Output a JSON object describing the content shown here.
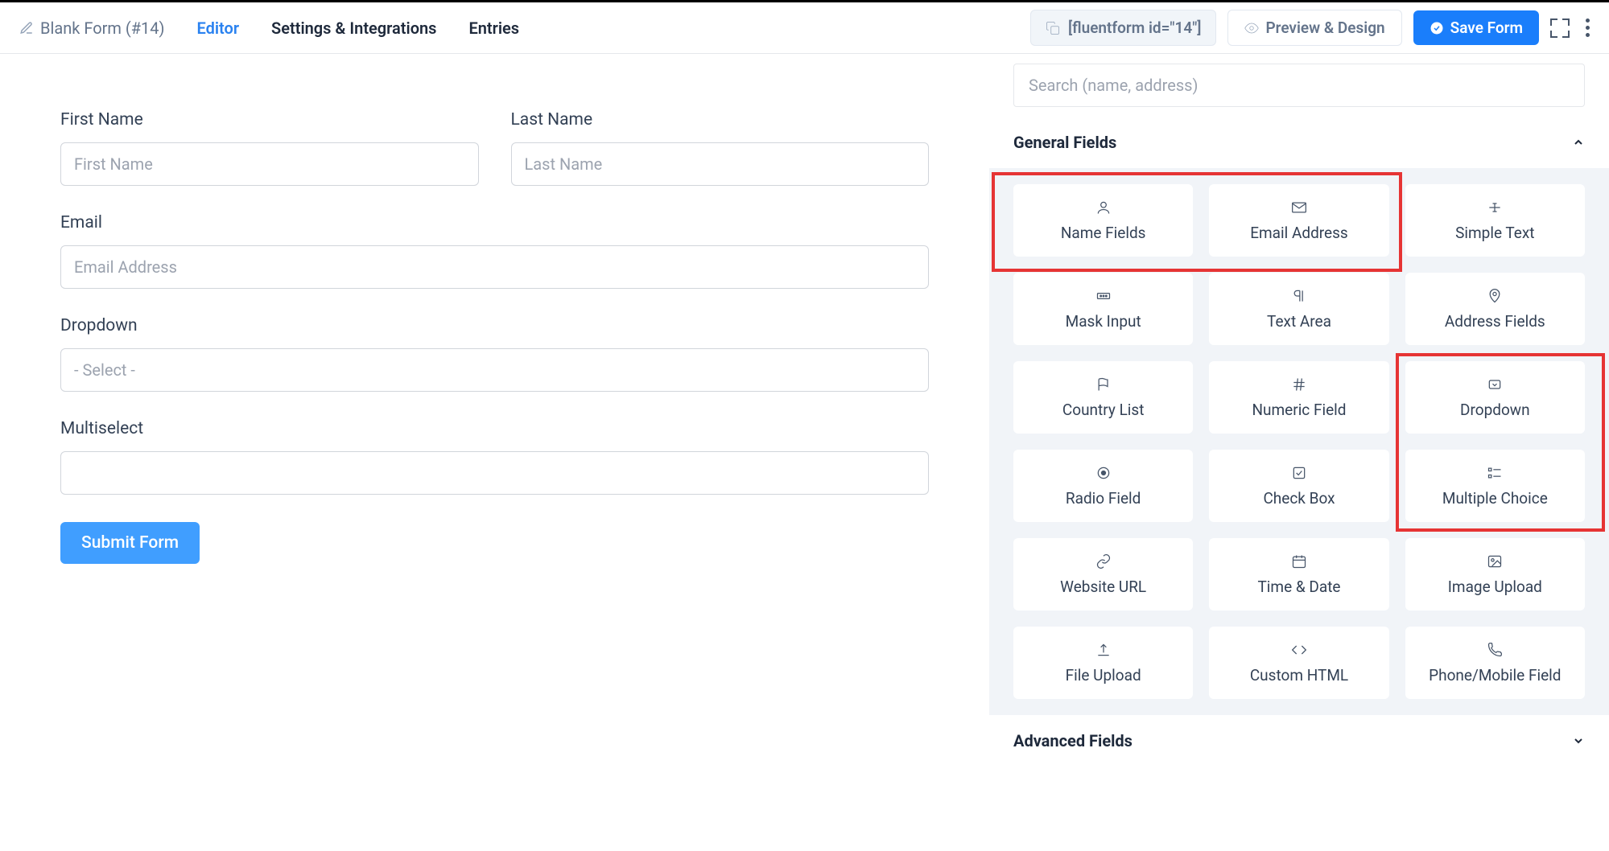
{
  "header": {
    "formTitle": "Blank Form (#14)",
    "tabs": {
      "editor": "Editor",
      "settings": "Settings & Integrations",
      "entries": "Entries"
    },
    "shortcode": "[fluentform id=\"14\"]",
    "previewBtn": "Preview & Design",
    "saveBtn": "Save Form"
  },
  "canvas": {
    "firstName": {
      "label": "First Name",
      "placeholder": "First Name"
    },
    "lastName": {
      "label": "Last Name",
      "placeholder": "Last Name"
    },
    "email": {
      "label": "Email",
      "placeholder": "Email Address"
    },
    "dropdown": {
      "label": "Dropdown",
      "placeholder": "- Select -"
    },
    "multiselect": {
      "label": "Multiselect"
    },
    "submitBtn": "Submit Form"
  },
  "sidebar": {
    "searchPlaceholder": "Search (name, address)",
    "generalTitle": "General Fields",
    "advancedTitle": "Advanced Fields",
    "fields": {
      "nameFields": "Name Fields",
      "emailAddress": "Email Address",
      "simpleText": "Simple Text",
      "maskInput": "Mask Input",
      "textArea": "Text Area",
      "addressFields": "Address Fields",
      "countryList": "Country List",
      "numericField": "Numeric Field",
      "dropdown": "Dropdown",
      "radioField": "Radio Field",
      "checkBox": "Check Box",
      "multipleChoice": "Multiple Choice",
      "websiteUrl": "Website URL",
      "timeDate": "Time & Date",
      "imageUpload": "Image Upload",
      "fileUpload": "File Upload",
      "customHtml": "Custom HTML",
      "phoneMobile": "Phone/Mobile Field"
    }
  }
}
